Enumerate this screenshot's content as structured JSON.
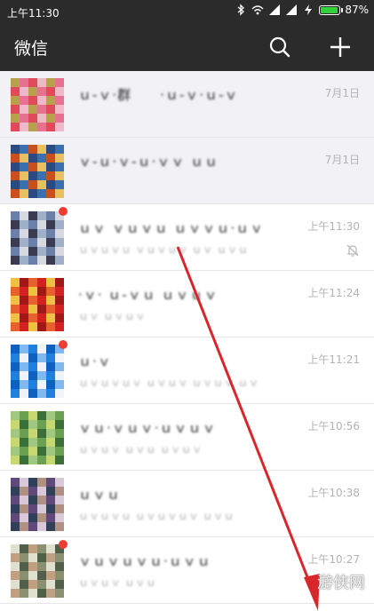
{
  "status_bar": {
    "time": "上午11:30",
    "battery_percent": "87%",
    "battery_level": 0.87,
    "icons": [
      "bluetooth-icon",
      "wifi-icon",
      "signal-icon",
      "signal-icon",
      "charging-icon",
      "battery-icon"
    ]
  },
  "app_bar": {
    "title": "微信",
    "search_icon": "search-icon",
    "add_icon": "plus-icon"
  },
  "chats": [
    {
      "time": "7月1日",
      "pinned": true,
      "badge": false,
      "muted": false,
      "palette": [
        "#e04a5a",
        "#f0b8c8",
        "#b8a050",
        "#e87090"
      ]
    },
    {
      "time": "7月1日",
      "pinned": true,
      "badge": false,
      "muted": false,
      "palette": [
        "#3a6fb0",
        "#c8501e",
        "#e8c060",
        "#2a4a80"
      ]
    },
    {
      "time": "上午11:30",
      "pinned": false,
      "badge": true,
      "muted": true,
      "palette": [
        "#6a80a8",
        "#d8d8e0",
        "#3a3a50",
        "#a0b0c8"
      ]
    },
    {
      "time": "上午11:24",
      "pinned": false,
      "badge": false,
      "muted": false,
      "palette": [
        "#d42020",
        "#f0c040",
        "#a01818",
        "#e86030"
      ]
    },
    {
      "time": "上午11:21",
      "pinned": false,
      "badge": true,
      "muted": false,
      "palette": [
        "#2080e0",
        "#f0f4fa",
        "#1060c0",
        "#80b8f0"
      ]
    },
    {
      "time": "上午10:56",
      "pinned": false,
      "badge": false,
      "muted": false,
      "palette": [
        "#6aa050",
        "#c8d870",
        "#3a7038",
        "#a0c880"
      ]
    },
    {
      "time": "上午10:38",
      "pinned": false,
      "badge": false,
      "muted": false,
      "palette": [
        "#604878",
        "#d8c8d8",
        "#304058",
        "#b09080"
      ]
    },
    {
      "time": "上午10:27",
      "pinned": false,
      "badge": true,
      "muted": false,
      "palette": [
        "#8a9070",
        "#e0e0d0",
        "#506048",
        "#c0a080"
      ]
    }
  ],
  "watermark": "游侠网"
}
